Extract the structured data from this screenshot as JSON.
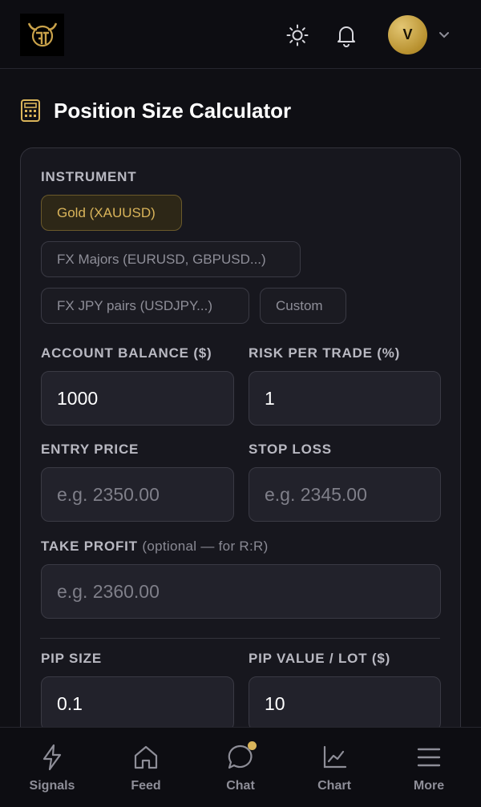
{
  "header": {
    "avatar_initial": "V"
  },
  "page": {
    "title": "Position Size Calculator"
  },
  "form": {
    "instrument_label": "INSTRUMENT",
    "instruments": [
      {
        "label": "Gold (XAUUSD)",
        "selected": true
      },
      {
        "label": "FX Majors (EURUSD, GBPUSD...)",
        "selected": false
      },
      {
        "label": "FX JPY pairs (USDJPY...)",
        "selected": false
      },
      {
        "label": "Custom",
        "selected": false
      }
    ],
    "account_balance": {
      "label": "ACCOUNT BALANCE ($)",
      "value": "1000"
    },
    "risk_per_trade": {
      "label": "RISK PER TRADE (%)",
      "value": "1"
    },
    "entry_price": {
      "label": "ENTRY PRICE",
      "placeholder": "e.g. 2350.00"
    },
    "stop_loss": {
      "label": "STOP LOSS",
      "placeholder": "e.g. 2345.00"
    },
    "take_profit": {
      "label": "TAKE PROFIT",
      "hint": "(optional — for R:R)",
      "placeholder": "e.g. 2360.00"
    },
    "pip_size": {
      "label": "PIP SIZE",
      "value": "0.1"
    },
    "pip_value": {
      "label": "PIP VALUE / LOT ($)",
      "value": "10"
    }
  },
  "bottom_nav": [
    {
      "label": "Signals",
      "icon": "lightning-icon"
    },
    {
      "label": "Feed",
      "icon": "home-icon"
    },
    {
      "label": "Chat",
      "icon": "chat-bubble-icon",
      "badge": true
    },
    {
      "label": "Chart",
      "icon": "line-chart-icon"
    },
    {
      "label": "More",
      "icon": "menu-icon"
    }
  ],
  "colors": {
    "accent_gold": "#d9b45a",
    "background": "#0f0f14",
    "card": "#17171e"
  }
}
